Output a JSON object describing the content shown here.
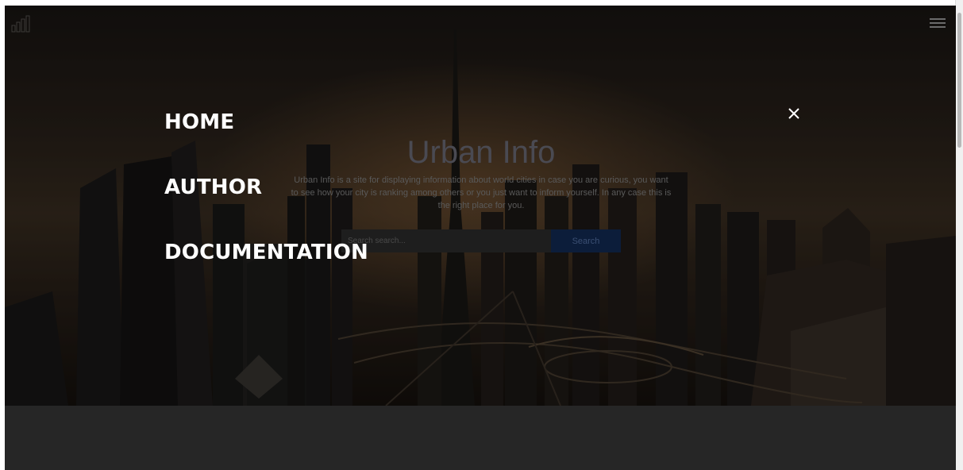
{
  "menu": {
    "items": [
      {
        "label": "HOME"
      },
      {
        "label": "AUTHOR"
      },
      {
        "label": "DOCUMENTATION"
      }
    ]
  },
  "hero": {
    "title": "Urban Info",
    "description": "Urban Info is a site for displaying information about world cities in case you are curious, you want to see how your city is ranking among others or you just want to inform yourself. In any case this is the right place for you.",
    "search": {
      "placeholder": "Search search...",
      "button_label": "Search"
    }
  },
  "icons": {
    "logo": "bar-chart-logo-icon",
    "menu": "hamburger-menu-icon",
    "close": "close-x-icon"
  },
  "colors": {
    "overlay_text": "#ffffff",
    "footer_band": "#262626",
    "search_button": "#0c1d3a"
  }
}
